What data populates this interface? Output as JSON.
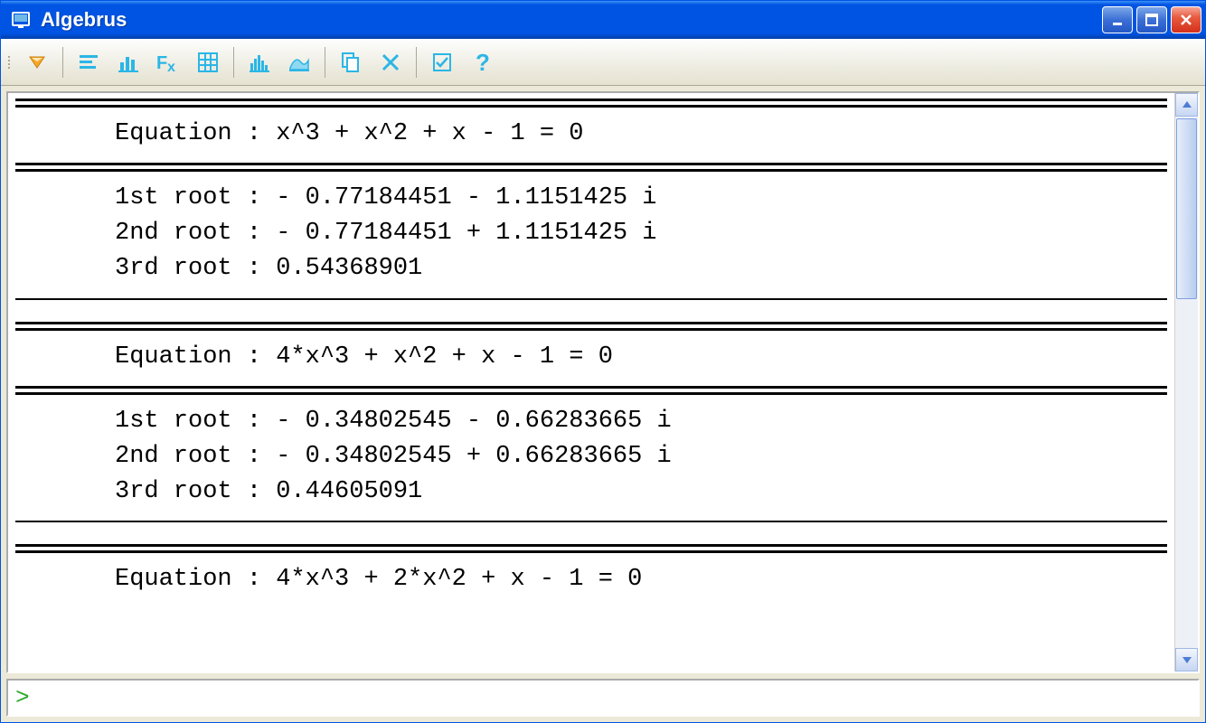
{
  "window": {
    "title": "Algebrus"
  },
  "colors": {
    "titlebar": "#0054e3",
    "icon": "#2bb6e6",
    "accent": "#f7a823"
  },
  "toolbar": {
    "icons": [
      "dropdown-icon",
      "align-left-icon",
      "bar-chart-icon",
      "fx-icon",
      "grid-icon",
      "histogram-icon",
      "surface-icon",
      "copy-icon",
      "delete-icon",
      "checkbox-icon",
      "help-icon"
    ]
  },
  "output": {
    "groups": [
      {
        "equation_label": "Equation : ",
        "equation": "x^3 + x^2 + x - 1 = 0",
        "roots": [
          {
            "label": "1st root : ",
            "value": "- 0.77184451 - 1.1151425 i"
          },
          {
            "label": "2nd root : ",
            "value": "- 0.77184451 + 1.1151425 i"
          },
          {
            "label": "3rd root : ",
            "value": "0.54368901"
          }
        ]
      },
      {
        "equation_label": "Equation : ",
        "equation": "4*x^3 + x^2 + x - 1 = 0",
        "roots": [
          {
            "label": "1st root : ",
            "value": "- 0.34802545 - 0.66283665 i"
          },
          {
            "label": "2nd root : ",
            "value": "- 0.34802545 + 0.66283665 i"
          },
          {
            "label": "3rd root : ",
            "value": "0.44605091"
          }
        ]
      },
      {
        "equation_label": "Equation : ",
        "equation": "4*x^3 + 2*x^2 + x - 1 = 0",
        "roots": []
      }
    ]
  },
  "input": {
    "prompt": ">",
    "value": ""
  }
}
